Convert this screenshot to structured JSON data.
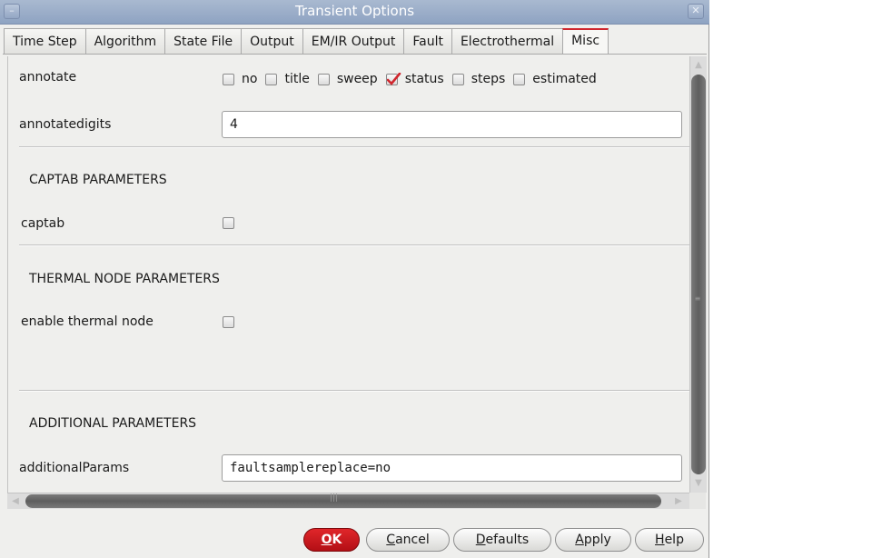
{
  "window": {
    "title": "Transient Options"
  },
  "tabs": [
    {
      "label": "Time Step"
    },
    {
      "label": "Algorithm"
    },
    {
      "label": "State File"
    },
    {
      "label": "Output"
    },
    {
      "label": "EM/IR Output"
    },
    {
      "label": "Fault"
    },
    {
      "label": "Electrothermal"
    },
    {
      "label": "Misc",
      "active": true
    }
  ],
  "annotate": {
    "label": "annotate",
    "options": [
      {
        "label": "no",
        "checked": false
      },
      {
        "label": "title",
        "checked": false
      },
      {
        "label": "sweep",
        "checked": false
      },
      {
        "label": "status",
        "checked": true
      },
      {
        "label": "steps",
        "checked": false
      },
      {
        "label": "estimated",
        "checked": false
      }
    ]
  },
  "annotatedigits": {
    "label": "annotatedigits",
    "value": "4"
  },
  "captab_section": {
    "heading": "CAPTAB PARAMETERS",
    "label": "captab",
    "checked": false
  },
  "thermal_section": {
    "heading": "THERMAL NODE PARAMETERS",
    "label": "enable thermal node",
    "checked": false
  },
  "additional_section": {
    "heading": "ADDITIONAL PARAMETERS",
    "label": "additionalParams",
    "value": "faultsamplereplace=no"
  },
  "buttons": {
    "ok": {
      "pre": "",
      "u": "O",
      "post": "K"
    },
    "cancel": {
      "pre": "",
      "u": "C",
      "post": "ancel"
    },
    "defaults": {
      "pre": "",
      "u": "D",
      "post": "efaults"
    },
    "apply": {
      "pre": "",
      "u": "A",
      "post": "pply"
    },
    "help": {
      "pre": "",
      "u": "H",
      "post": "elp"
    }
  },
  "colors": {
    "accent": "#d0262d",
    "titlebar": "#9aaeca",
    "check": "#d0262d"
  },
  "icons": {
    "window_menu": "minus-icon",
    "window_close": "close-icon"
  }
}
